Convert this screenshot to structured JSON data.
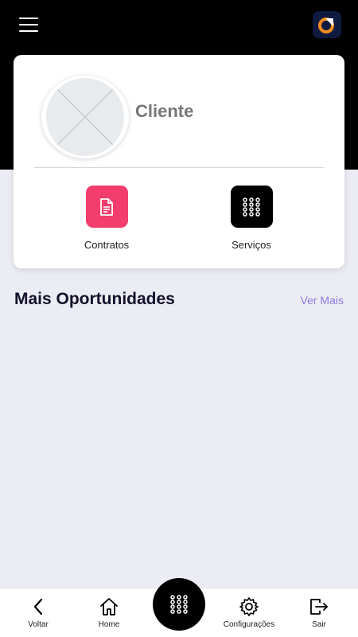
{
  "header": {
    "menu_icon": "hamburger-menu-icon",
    "logo_icon": "app-logo-icon",
    "logo_colors": {
      "background": "#0e1a40",
      "accent": "#f28c1e",
      "mark": "#ffffff"
    }
  },
  "profile": {
    "name": "Cliente",
    "avatar_icon": "placeholder-avatar-icon"
  },
  "actions": [
    {
      "label": "Contratos",
      "icon": "document-icon",
      "color": "#f23d6d"
    },
    {
      "label": "Serviços",
      "icon": "grid-dots-icon",
      "color": "#000000"
    }
  ],
  "opportunities": {
    "title": "Mais Oportunidades",
    "see_more": "Ver Mais"
  },
  "bottom_nav": {
    "items": [
      {
        "label": "Voltar",
        "icon": "chevron-left-icon"
      },
      {
        "label": "Home",
        "icon": "home-icon"
      },
      {
        "label": "Configurações",
        "icon": "gear-icon"
      },
      {
        "label": "Sair",
        "icon": "logout-icon"
      }
    ],
    "center_icon": "grid-dots-icon"
  },
  "colors": {
    "header_bg": "#000000",
    "page_bg": "#ececf4",
    "accent_link": "#8e7cdb",
    "title_text": "#13112b"
  }
}
